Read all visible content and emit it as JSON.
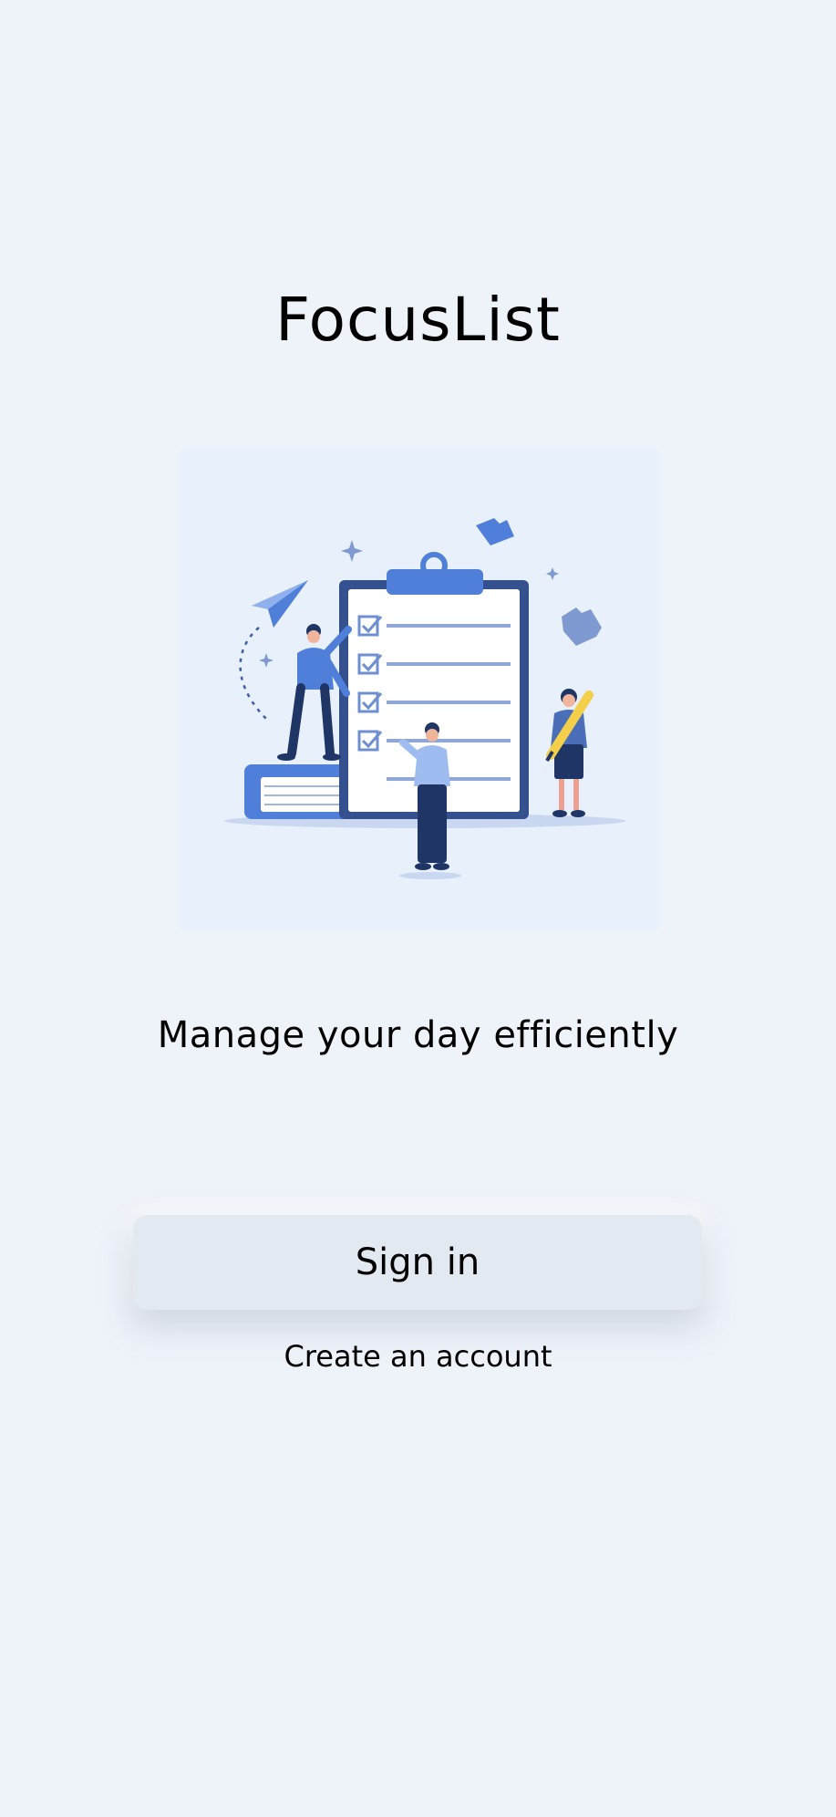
{
  "app": {
    "title": "FocusList",
    "tagline": "Manage your day efficiently"
  },
  "illustration": {
    "icon": "checklist-team-illustration",
    "accent": "#4f7fd8",
    "dark": "#1f3566",
    "highlight": "#f3cf4a"
  },
  "actions": {
    "sign_in_label": "Sign in",
    "create_account_label": "Create an account"
  }
}
